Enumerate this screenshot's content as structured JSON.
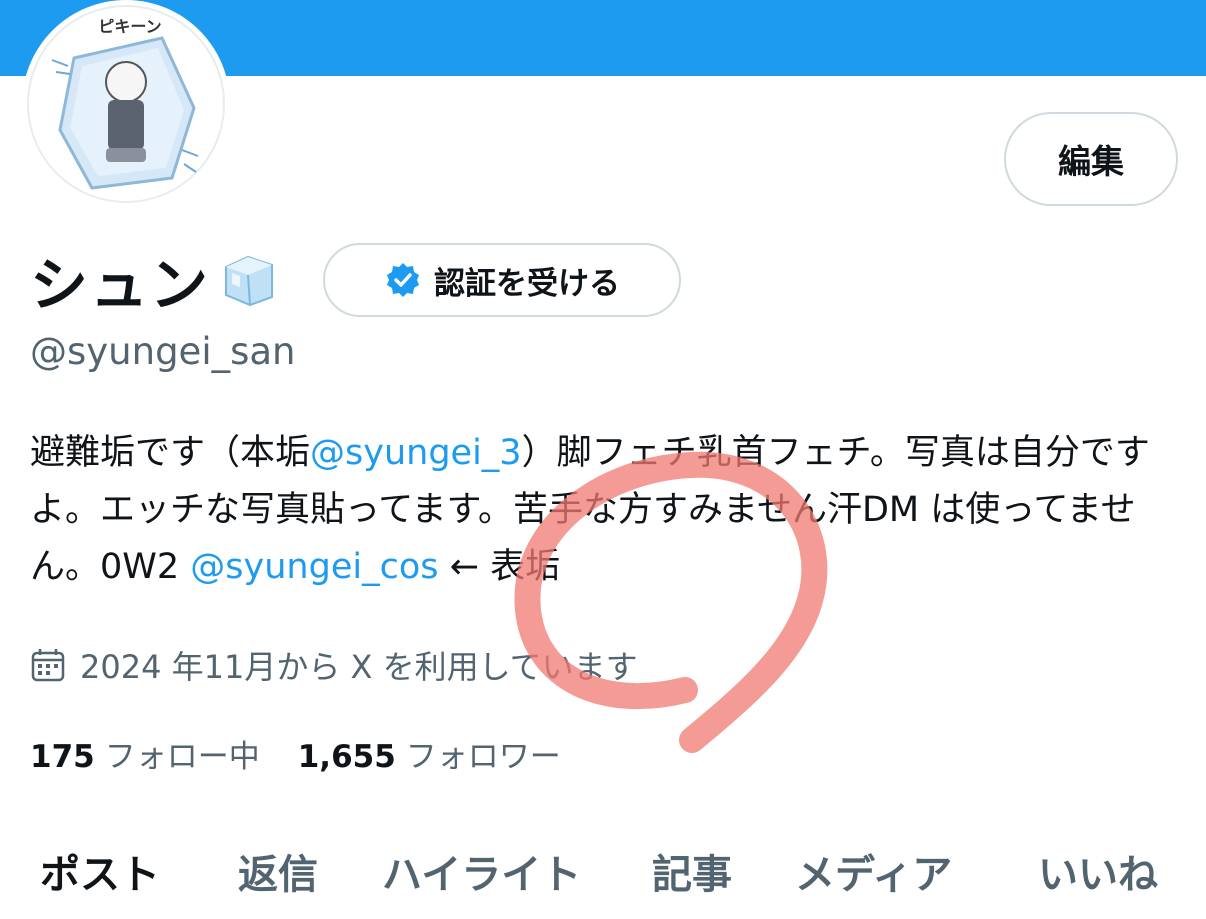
{
  "profile": {
    "display_name": "シュン",
    "handle": "@syungei_san",
    "edit_label": "編集",
    "verify_label": "認証を受ける",
    "avatar_caption": "ピキーン",
    "bio": {
      "p1": "避難垢です（本垢",
      "mention1": "@syungei_3",
      "p2": "）脚フェチ乳首フェチ。写真は自分ですよ。エッチな写真貼ってます。苦手な方すみません汗DM は使ってません。0W2",
      "mention2": "@syungei_cos",
      "p3": "← 表垢"
    },
    "joined": "2024 年11月から X を利用しています",
    "following_count": "175",
    "following_label": "フォロー中",
    "followers_count": "1,655",
    "followers_label": "フォロワー"
  },
  "tabs": [
    {
      "label": "ポスト",
      "active": true
    },
    {
      "label": "返信",
      "active": false
    },
    {
      "label": "ハイライト",
      "active": false
    },
    {
      "label": "記事",
      "active": false
    },
    {
      "label": "メディア",
      "active": false
    },
    {
      "label": "いいね",
      "active": false
    }
  ],
  "icons": {
    "verified": "verified-badge-icon",
    "calendar": "calendar-icon",
    "name_emoji": "ice-cube-icon"
  },
  "colors": {
    "banner": "#1d9bf0",
    "link": "#1d9bf0",
    "secondary_text": "#536471",
    "annotation_circle": "#f07a72"
  }
}
